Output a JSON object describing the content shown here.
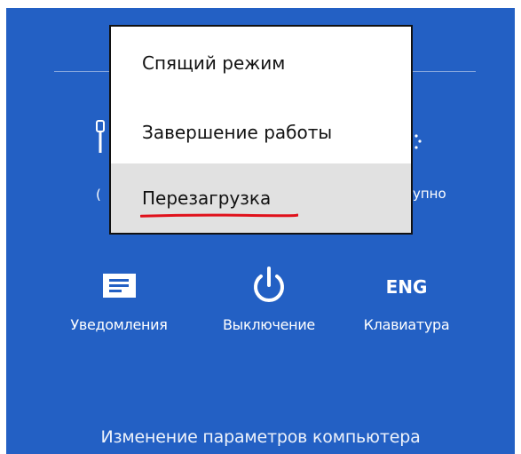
{
  "charm_panel": {
    "background_color": "#2360c4",
    "partial_left_label": "(",
    "partial_right_label": "упно",
    "tiles": [
      {
        "label": "Уведомления",
        "icon": "notifications-icon"
      },
      {
        "label": "Выключение",
        "icon": "power-icon"
      },
      {
        "label": "Клавиатура",
        "icon": "keyboard-language-icon",
        "icon_text": "ENG"
      }
    ],
    "footer_link": "Изменение параметров компьютера"
  },
  "power_menu": {
    "items": [
      {
        "label": "Спящий режим"
      },
      {
        "label": "Завершение работы"
      },
      {
        "label": "Перезагрузка",
        "selected": true,
        "annotation": "red-underline"
      }
    ],
    "highlight_color": "#e1e1e1",
    "annotation_color": "#e0111b"
  }
}
